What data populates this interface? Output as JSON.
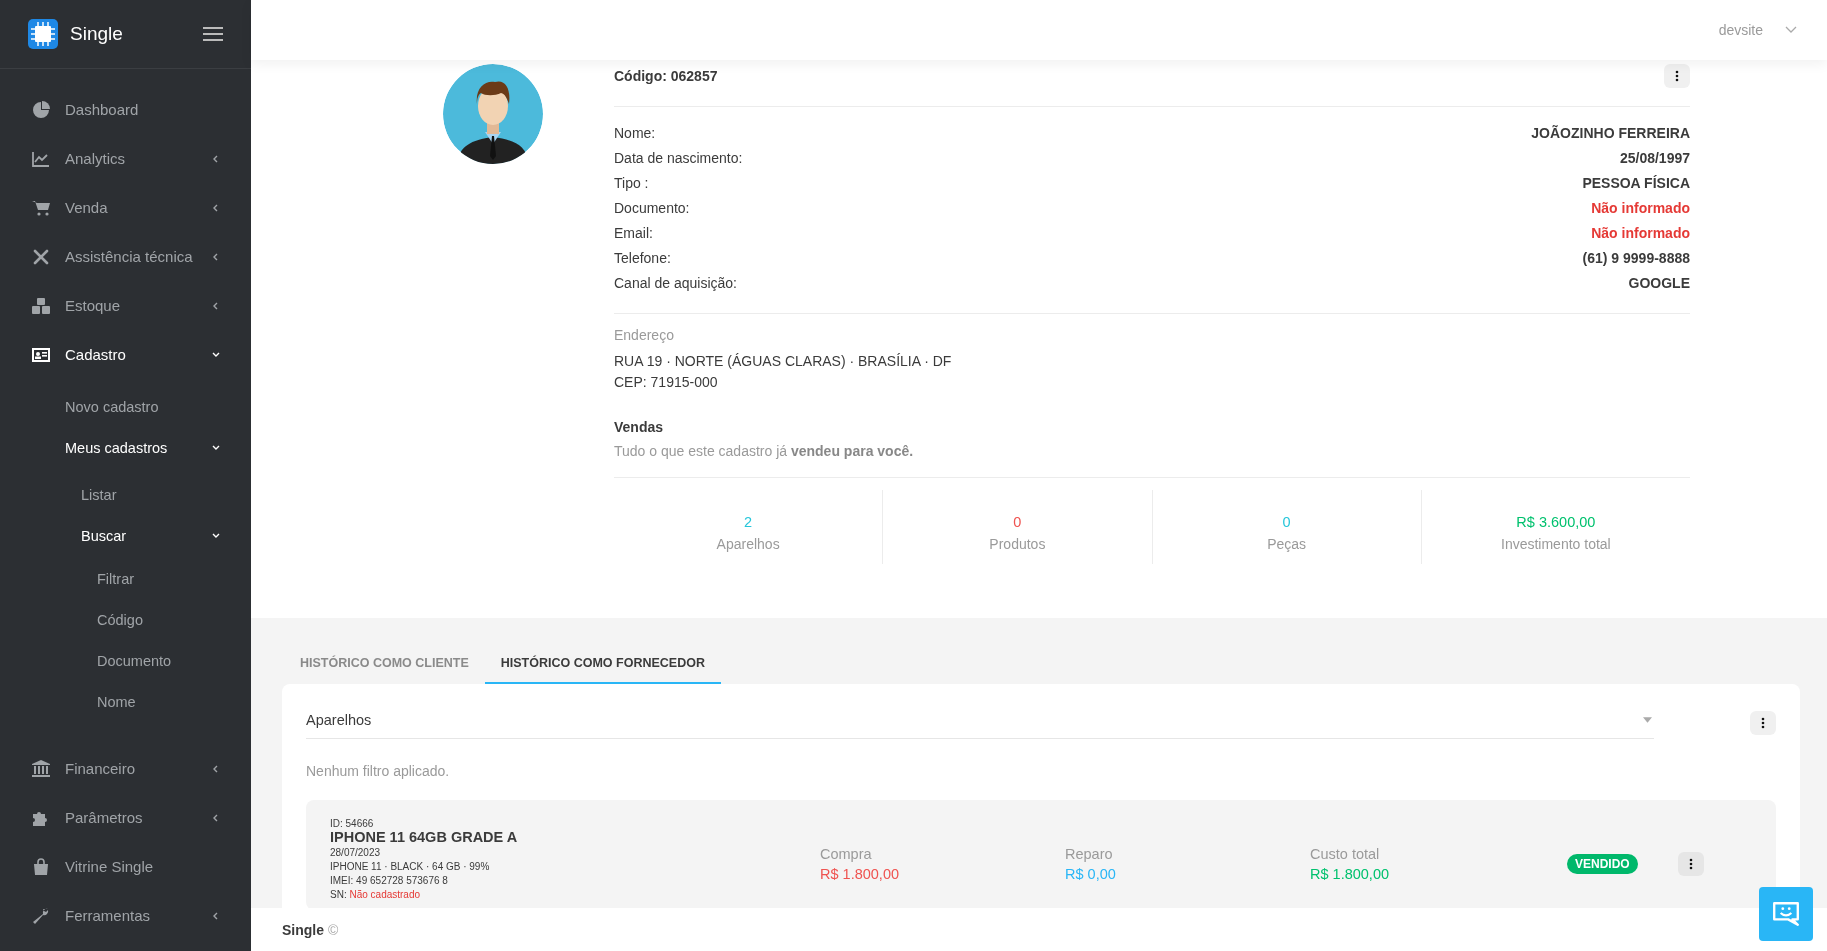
{
  "sidebar": {
    "brand": "Single",
    "items": [
      {
        "label": "Dashboard",
        "kind": "link"
      },
      {
        "label": "Analytics",
        "kind": "group",
        "expanded": false
      },
      {
        "label": "Venda",
        "kind": "group",
        "expanded": false
      },
      {
        "label": "Assistência técnica",
        "kind": "group",
        "expanded": false
      },
      {
        "label": "Estoque",
        "kind": "group",
        "expanded": false
      },
      {
        "label": "Cadastro",
        "kind": "group",
        "expanded": true,
        "children": [
          {
            "label": "Novo cadastro",
            "kind": "link"
          },
          {
            "label": "Meus cadastros",
            "kind": "group",
            "expanded": true,
            "children": [
              {
                "label": "Listar",
                "kind": "link"
              },
              {
                "label": "Buscar",
                "kind": "group",
                "expanded": true,
                "children": [
                  {
                    "label": "Filtrar"
                  },
                  {
                    "label": "Código"
                  },
                  {
                    "label": "Documento"
                  },
                  {
                    "label": "Nome"
                  }
                ]
              }
            ]
          }
        ]
      },
      {
        "label": "Financeiro",
        "kind": "group",
        "expanded": false
      },
      {
        "label": "Parâmetros",
        "kind": "group",
        "expanded": false
      },
      {
        "label": "Vitrine Single",
        "kind": "link"
      },
      {
        "label": "Ferramentas",
        "kind": "group",
        "expanded": false
      }
    ]
  },
  "header": {
    "user": "devsite"
  },
  "profile": {
    "code": "Código: 062857",
    "details": [
      {
        "label": "Nome:",
        "value": "JOÃOZINHO FERREIRA",
        "missing": false
      },
      {
        "label": "Data de nascimento:",
        "value": "25/08/1997",
        "missing": false
      },
      {
        "label": "Tipo :",
        "value": "PESSOA FÍSICA",
        "missing": false
      },
      {
        "label": "Documento:",
        "value": "Não informado",
        "missing": true
      },
      {
        "label": "Email:",
        "value": "Não informado",
        "missing": true
      },
      {
        "label": "Telefone:",
        "value": "(61) 9 9999-8888",
        "missing": false
      },
      {
        "label": "Canal de aquisição:",
        "value": "GOOGLE",
        "missing": false
      }
    ],
    "address_title": "Endereço",
    "address_lines": [
      "RUA 19 · NORTE (ÁGUAS CLARAS) · BRASÍLIA · DF",
      "CEP: 71915-000"
    ],
    "sales_title": "Vendas",
    "sales_text": "Tudo o que este cadastro já **vendeu para você.**",
    "stats": [
      {
        "value": "2",
        "label": "Aparelhos",
        "color": "#26c6da"
      },
      {
        "value": "0",
        "label": "Produtos",
        "color": "#ef5350"
      },
      {
        "value": "0",
        "label": "Peças",
        "color": "#26c6da"
      },
      {
        "value": "R$ 3.600,00",
        "label": "Investimento total",
        "color": "#00c16e"
      }
    ]
  },
  "tabs": [
    {
      "label": "HISTÓRICO COMO CLIENTE",
      "selected": false
    },
    {
      "label": "HISTÓRICO COMO FORNECEDOR",
      "selected": true
    }
  ],
  "history": {
    "select": {
      "value": "Aparelhos"
    },
    "filter_note": "Nenhum filtro aplicado.",
    "records": [
      {
        "id": "ID: 54666",
        "title": "IPHONE 11 64GB GRADE A",
        "date": "28/07/2023",
        "specs": "IPHONE 11 · BLACK · 64 GB · 99%",
        "imei": "IMEI: 49 652728 573676 8",
        "sn_label": "SN:",
        "sn_value": "Não cadastrado",
        "amounts": [
          {
            "label": "Compra",
            "value": "R$ 1.800,00",
            "color": "#ef5350"
          },
          {
            "label": "Reparo",
            "value": "R$ 0,00",
            "color": "#29b6f6"
          },
          {
            "label": "Custo total",
            "value": "R$ 1.800,00",
            "color": "#00c16e"
          }
        ],
        "status": "VENDIDO"
      }
    ]
  },
  "footer": {
    "brand": "Single",
    "mark": "©"
  }
}
